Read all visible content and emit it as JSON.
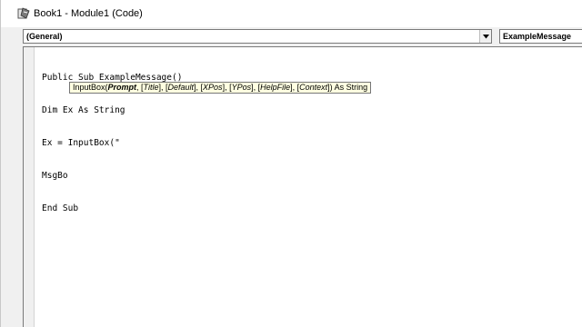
{
  "window": {
    "title": "Book1 - Module1 (Code)"
  },
  "toolbar": {
    "object_combo": "(General)",
    "procedure_combo": "ExampleMessage"
  },
  "code_lines": [
    "Public Sub ExampleMessage()",
    "Dim Ex As String",
    "Ex = InputBox(\"",
    "MsgBo",
    "End Sub"
  ],
  "tooltip": {
    "prefix": "InputBox(",
    "active_param": "Prompt",
    "rest_a": ", [",
    "p_title": "Title",
    "sep1": "], [",
    "p_default": "Default",
    "sep2": "], [",
    "p_xpos": "XPos",
    "sep3": "], [",
    "p_ypos": "YPos",
    "sep4": "], [",
    "p_helpfile": "HelpFile",
    "sep5": "], [",
    "p_context": "Context",
    "suffix": "]) As String"
  },
  "icons": {
    "app": "vba-module-icon",
    "dropdown": "chevron-down-icon"
  }
}
